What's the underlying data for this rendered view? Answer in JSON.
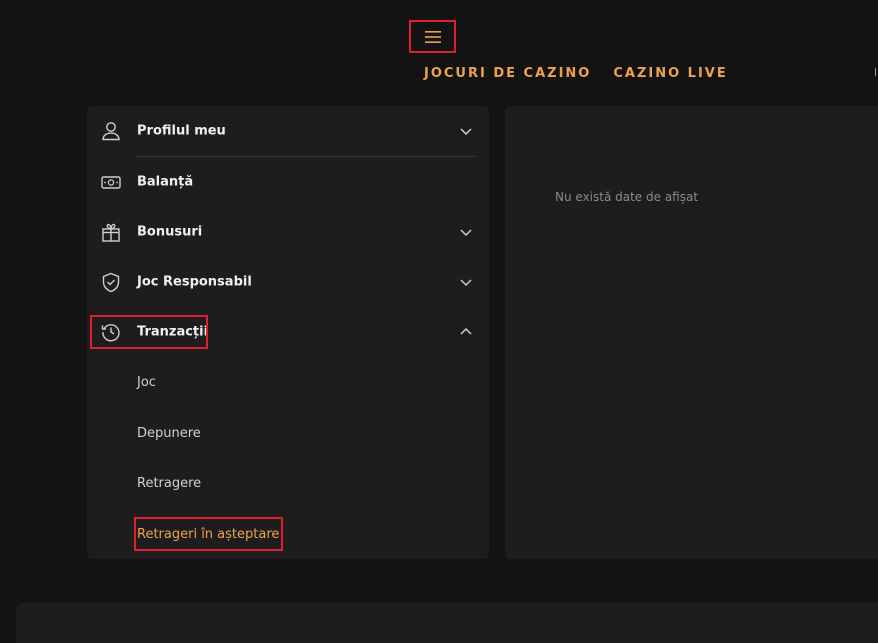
{
  "header": {
    "menu_icon": "hamburger-icon",
    "nav": [
      {
        "label": "JOCURI DE CAZINO"
      },
      {
        "label": "CAZINO LIVE"
      }
    ]
  },
  "sidebar": {
    "items": [
      {
        "label": "Profilul meu",
        "icon": "user-icon",
        "chevron": "chevron-down-icon"
      },
      {
        "label": "Balanță",
        "icon": "cash-icon"
      },
      {
        "label": "Bonusuri",
        "icon": "gift-icon",
        "chevron": "chevron-down-icon"
      },
      {
        "label": "Joc Responsabil",
        "icon": "shield-check-icon",
        "chevron": "chevron-down-icon"
      },
      {
        "label": "Tranzacții",
        "icon": "history-icon",
        "chevron": "chevron-up-icon",
        "expanded": true
      }
    ],
    "transactions_sub": [
      {
        "label": "Joc"
      },
      {
        "label": "Depunere"
      },
      {
        "label": "Retragere"
      },
      {
        "label": "Retrageri în așteptare",
        "active": true
      }
    ]
  },
  "content": {
    "empty_message": "Nu există date de afișat"
  },
  "colors": {
    "accent": "#f0a24a",
    "highlight_box": "#e01e2d",
    "background": "#131313",
    "panel": "#1d1d1d"
  }
}
